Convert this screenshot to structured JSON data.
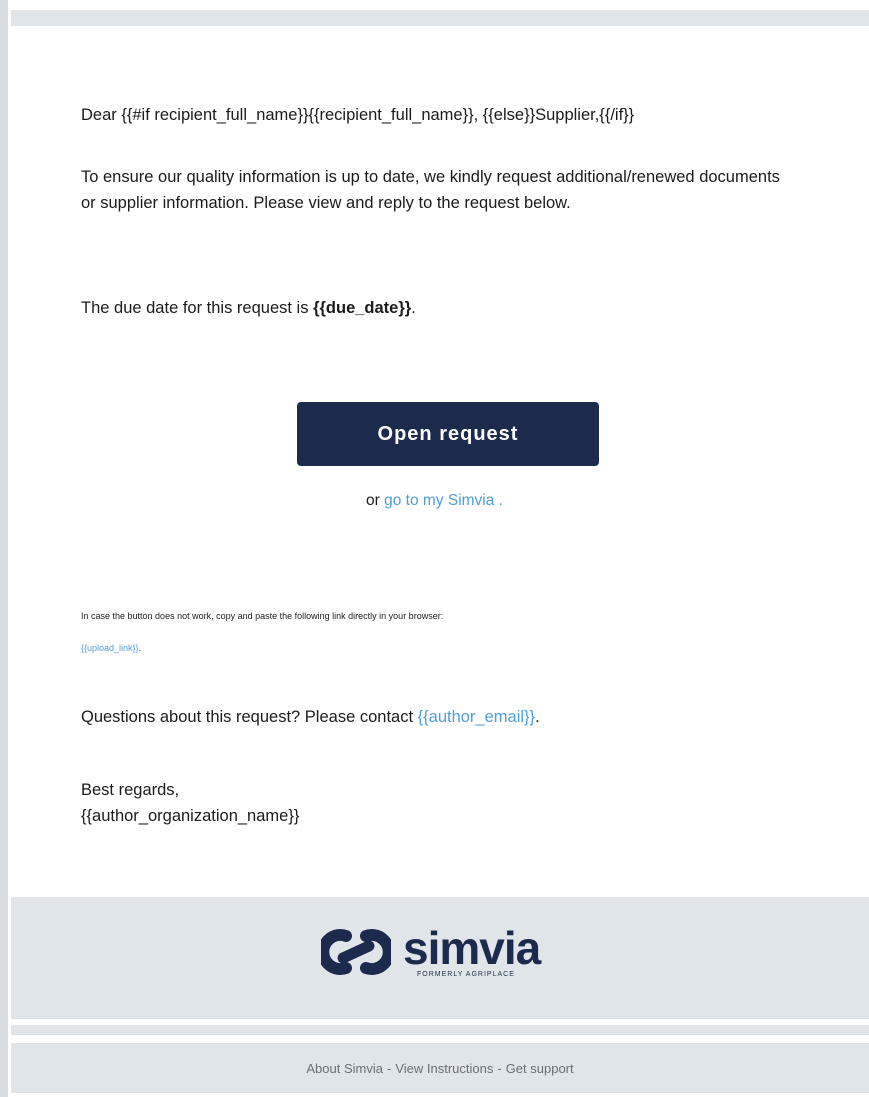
{
  "email": {
    "greeting": "Dear {{#if recipient_full_name}}{{recipient_full_name}}, {{else}}Supplier,{{/if}}",
    "intro": "To ensure our quality information is up to date, we kindly request additional/renewed documents or supplier information. Please view and reply to the request below.",
    "due_prefix": "The due date for this request is ",
    "due_value": "{{due_date}}",
    "due_suffix": ".",
    "open_button": "Open request",
    "alt_prefix": "or ",
    "alt_link": "go to my Simvia .",
    "fallback_note": "In case the button does not work, copy and paste the following link directly in your browser:",
    "upload_link": "{{upload_link}}",
    "upload_link_suffix": ".",
    "questions_prefix": "Questions about this request? Please contact ",
    "author_email": "{{author_email}}",
    "questions_suffix": ".",
    "closing": "Best regards,",
    "signature": "{{author_organization_name}}"
  },
  "footer": {
    "logo_word": "simvia",
    "logo_tagline": "FORMERLY AGRIPLACE",
    "logo_icon": "simvia-logo-icon",
    "links": [
      "About Simvia",
      "View Instructions",
      "Get support"
    ],
    "separator": " - "
  },
  "colors": {
    "button": "#1c2b4d",
    "link": "#4f9fd6",
    "footer_bg": "#e0e5e9"
  }
}
